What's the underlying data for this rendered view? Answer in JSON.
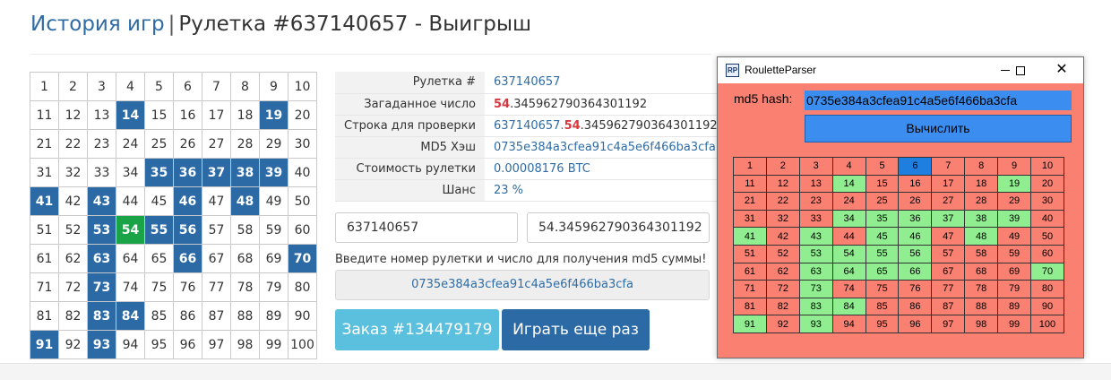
{
  "header": {
    "crumb": "История игр",
    "separator": "|",
    "title": "Рулетка #637140657 - Выигрыш"
  },
  "grid": {
    "start": 1,
    "end": 100,
    "highlighted": [
      14,
      19,
      35,
      36,
      37,
      38,
      39,
      41,
      43,
      46,
      48,
      53,
      55,
      56,
      63,
      66,
      70,
      73,
      83,
      84,
      91,
      93
    ],
    "winning": 54,
    "colors": {
      "highlight": "#2c6aa6",
      "winning": "#1aa447"
    }
  },
  "info": {
    "roulette_label": "Рулетка #",
    "roulette_value": "637140657",
    "guessed_label": "Загаданное число",
    "guessed_bold": "54",
    "guessed_rest": ".345962790364301192",
    "check_label": "Строка для проверки",
    "check_prefix": "637140657.",
    "check_bold": "54",
    "check_rest": ".345962790364301192",
    "md5_label": "MD5 Хэш",
    "md5_value": "0735e384a3cfea91c4a5e6f466ba3cfa",
    "cost_label": "Стоимость рулетки",
    "cost_value": "0.00008176 BTC",
    "chance_label": "Шанс",
    "chance_value": "23 %"
  },
  "form": {
    "roulette_input": "637140657",
    "number_input": "54.345962790364301192",
    "hint": "Введите номер рулетки и число для получения md5 суммы!",
    "hash_output": "0735e384a3cfea91c4a5e6f466ba3cfa",
    "order_button": "Заказ #134479179",
    "play_again_button": "Играть еще раз"
  },
  "window": {
    "icon_text": "RP",
    "title": "RouletteParser",
    "close_glyph": "✕",
    "md5_label": "md5 hash:",
    "md5_value": "0735e384a3cfea91c4a5e6f466ba3cfa",
    "compute_button": "Вычислить",
    "grid": {
      "green": [
        14,
        19,
        34,
        35,
        36,
        37,
        38,
        39,
        41,
        43,
        45,
        46,
        48,
        53,
        54,
        55,
        56,
        63,
        64,
        65,
        66,
        70,
        73,
        83,
        84,
        91,
        93
      ],
      "blue": [
        6
      ],
      "colors": {
        "base": "#fa8072",
        "green": "#90ee90",
        "blue": "#1e7fe0"
      }
    }
  }
}
